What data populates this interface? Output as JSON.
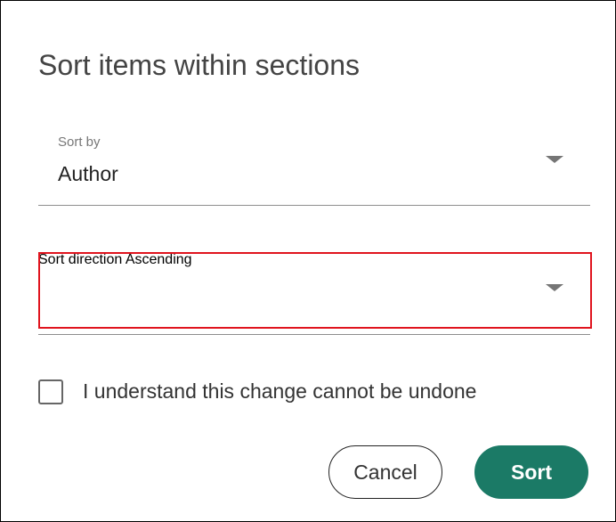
{
  "dialog": {
    "title": "Sort items within sections"
  },
  "sort_by": {
    "label": "Sort by",
    "value": "Author"
  },
  "sort_direction": {
    "label": "Sort direction",
    "value": "Ascending",
    "highlight_color": "#e0141e"
  },
  "confirm_checkbox": {
    "label": "I understand this change cannot be undone",
    "checked": false
  },
  "buttons": {
    "cancel_label": "Cancel",
    "sort_label": "Sort",
    "primary_color": "#1b7a66"
  },
  "icons": {
    "dropdown": "chevron-down-icon",
    "checkbox": "checkbox-unchecked-icon"
  }
}
